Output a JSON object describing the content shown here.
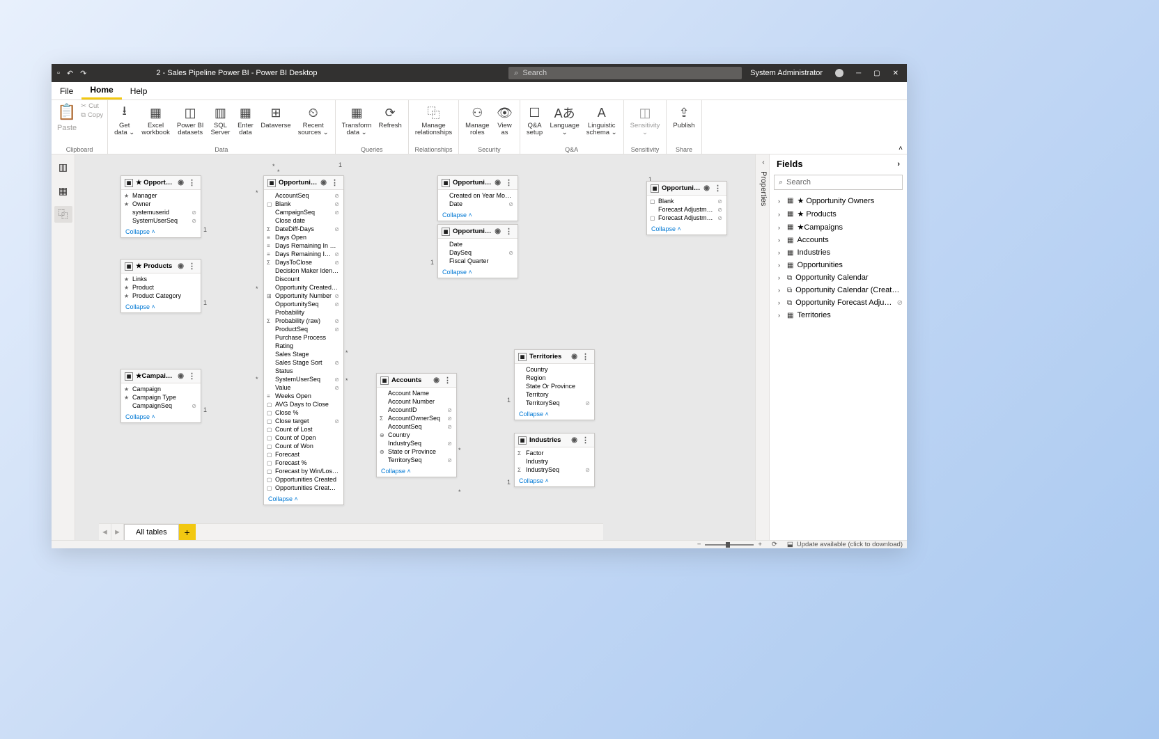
{
  "titlebar": {
    "title": "2 - Sales Pipeline Power BI - Power BI Desktop",
    "search_placeholder": "Search",
    "user": "System Administrator"
  },
  "menubar": [
    "File",
    "Home",
    "Help"
  ],
  "ribbon": {
    "clipboard": {
      "paste": "Paste",
      "cut": "Cut",
      "copy": "Copy",
      "label": "Clipboard"
    },
    "data": {
      "items": [
        {
          "label": "Get\ndata ⌄"
        },
        {
          "label": "Excel\nworkbook"
        },
        {
          "label": "Power BI\ndatasets"
        },
        {
          "label": "SQL\nServer"
        },
        {
          "label": "Enter\ndata"
        },
        {
          "label": "Dataverse"
        },
        {
          "label": "Recent\nsources ⌄"
        }
      ],
      "label": "Data"
    },
    "queries": {
      "items": [
        {
          "label": "Transform\ndata ⌄"
        },
        {
          "label": "Refresh"
        }
      ],
      "label": "Queries"
    },
    "relationships": {
      "items": [
        {
          "label": "Manage\nrelationships"
        }
      ],
      "label": "Relationships"
    },
    "security": {
      "items": [
        {
          "label": "Manage\nroles"
        },
        {
          "label": "View\nas"
        }
      ],
      "label": "Security"
    },
    "qa": {
      "items": [
        {
          "label": "Q&A\nsetup"
        },
        {
          "label": "Language\n⌄"
        },
        {
          "label": "Linguistic\nschema ⌄"
        }
      ],
      "label": "Q&A"
    },
    "sensitivity": {
      "items": [
        {
          "label": "Sensitivity\n⌄"
        }
      ],
      "label": "Sensitivity"
    },
    "share": {
      "items": [
        {
          "label": "Publish"
        }
      ],
      "label": "Share"
    }
  },
  "fields_pane": {
    "title": "Fields",
    "search_placeholder": "Search",
    "tables": [
      {
        "name": "★ Opportunity Owners",
        "ico": "▦"
      },
      {
        "name": "★ Products",
        "ico": "▦"
      },
      {
        "name": "★Campaigns",
        "ico": "▦"
      },
      {
        "name": "Accounts",
        "ico": "▦"
      },
      {
        "name": "Industries",
        "ico": "▦"
      },
      {
        "name": "Opportunities",
        "ico": "▦"
      },
      {
        "name": "Opportunity Calendar",
        "ico": "⧉"
      },
      {
        "name": "Opportunity Calendar (Created On)",
        "ico": "⧉"
      },
      {
        "name": "Opportunity Forecast Adjustment",
        "ico": "⧉",
        "hidden": true
      },
      {
        "name": "Territories",
        "ico": "▦"
      }
    ]
  },
  "properties_label": "Properties",
  "tabstrip": {
    "page": "All tables"
  },
  "statusbar": {
    "update": "Update available (click to download)"
  },
  "tables": {
    "opp_owners": {
      "title": "★ Opportunity Owners",
      "fields": [
        {
          "n": "Manager",
          "i": "★"
        },
        {
          "n": "Owner",
          "i": "★"
        },
        {
          "n": "systemuserid",
          "h": true
        },
        {
          "n": "SystemUserSeq",
          "h": true
        }
      ]
    },
    "products": {
      "title": "★ Products",
      "fields": [
        {
          "n": "Links",
          "i": "★"
        },
        {
          "n": "Product",
          "i": "★"
        },
        {
          "n": "Product Category",
          "i": "★"
        }
      ]
    },
    "campaigns": {
      "title": "★Campaigns",
      "fields": [
        {
          "n": "Campaign",
          "i": "★"
        },
        {
          "n": "Campaign Type",
          "i": "★"
        },
        {
          "n": "CampaignSeq",
          "h": true
        }
      ]
    },
    "opportunities": {
      "title": "Opportunities",
      "fields": [
        {
          "n": "AccountSeq",
          "h": true
        },
        {
          "n": "Blank",
          "i": "▢",
          "h": true
        },
        {
          "n": "CampaignSeq",
          "h": true
        },
        {
          "n": "Close date"
        },
        {
          "n": "DateDiff-Days",
          "i": "Σ",
          "h": true
        },
        {
          "n": "Days Open",
          "i": "≡"
        },
        {
          "n": "Days Remaining In Pipeline",
          "i": "≡"
        },
        {
          "n": "Days Remaining In Pipeline (bi...",
          "i": "≡",
          "h": true
        },
        {
          "n": "DaysToClose",
          "i": "Σ",
          "h": true
        },
        {
          "n": "Decision Maker Identified"
        },
        {
          "n": "Discount"
        },
        {
          "n": "Opportunity Created On"
        },
        {
          "n": "Opportunity Number",
          "i": "⊞",
          "h": true
        },
        {
          "n": "OpportunitySeq",
          "h": true
        },
        {
          "n": "Probability"
        },
        {
          "n": "Probability (raw)",
          "i": "Σ",
          "h": true
        },
        {
          "n": "ProductSeq",
          "h": true
        },
        {
          "n": "Purchase Process"
        },
        {
          "n": "Rating"
        },
        {
          "n": "Sales Stage"
        },
        {
          "n": "Sales Stage Sort",
          "h": true
        },
        {
          "n": "Status"
        },
        {
          "n": "SystemUserSeq",
          "h": true
        },
        {
          "n": "Value",
          "h": true
        },
        {
          "n": "Weeks Open",
          "i": "≡"
        },
        {
          "n": "AVG Days to Close",
          "i": "▢"
        },
        {
          "n": "Close %",
          "i": "▢"
        },
        {
          "n": "Close target",
          "i": "▢",
          "h": true
        },
        {
          "n": "Count of Lost",
          "i": "▢"
        },
        {
          "n": "Count of Open",
          "i": "▢"
        },
        {
          "n": "Count of Won",
          "i": "▢"
        },
        {
          "n": "Forecast",
          "i": "▢"
        },
        {
          "n": "Forecast %",
          "i": "▢"
        },
        {
          "n": "Forecast by Win/Loss Ratio",
          "i": "▢"
        },
        {
          "n": "Opportunities Created",
          "i": "▢"
        },
        {
          "n": "Opportunities Created - MoM ...",
          "i": "▢"
        }
      ]
    },
    "opp_cal_created": {
      "title": "Opportunity Calenda...",
      "fields": [
        {
          "n": "Created on Year Month"
        },
        {
          "n": "Date",
          "h": true
        }
      ]
    },
    "opp_cal": {
      "title": "Opportunity Calendar",
      "fields": [
        {
          "n": "Date"
        },
        {
          "n": "DaySeq",
          "h": true
        },
        {
          "n": "Fiscal Quarter"
        }
      ]
    },
    "forecast": {
      "title": "Opportunity Forecast...",
      "fields": [
        {
          "n": "Blank",
          "i": "▢",
          "h": true
        },
        {
          "n": "Forecast Adjustment",
          "h": true
        },
        {
          "n": "Forecast Adjustment Va...",
          "i": "▢",
          "h": true
        }
      ]
    },
    "territories": {
      "title": "Territories",
      "fields": [
        {
          "n": "Country"
        },
        {
          "n": "Region"
        },
        {
          "n": "State Or Province"
        },
        {
          "n": "Territory"
        },
        {
          "n": "TerritorySeq",
          "h": true
        }
      ]
    },
    "accounts": {
      "title": "Accounts",
      "fields": [
        {
          "n": "Account Name"
        },
        {
          "n": "Account Number"
        },
        {
          "n": "AccountID",
          "h": true
        },
        {
          "n": "AccountOwnerSeq",
          "i": "Σ",
          "h": true
        },
        {
          "n": "AccountSeq",
          "h": true
        },
        {
          "n": "Country",
          "i": "⊕"
        },
        {
          "n": "IndustrySeq",
          "h": true
        },
        {
          "n": "State or Province",
          "i": "⊕"
        },
        {
          "n": "TerritorySeq",
          "h": true
        }
      ]
    },
    "industries": {
      "title": "Industries",
      "fields": [
        {
          "n": "Factor",
          "i": "Σ"
        },
        {
          "n": "Industry"
        },
        {
          "n": "IndustrySeq",
          "i": "Σ",
          "h": true
        }
      ]
    }
  },
  "collapse_label": "Collapse"
}
